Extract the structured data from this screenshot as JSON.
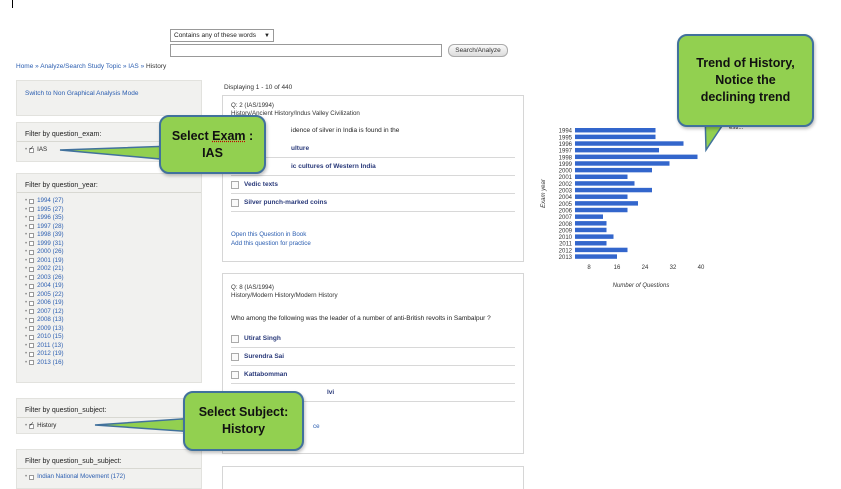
{
  "search": {
    "mode_select": "Contains any of these words",
    "input_value": "",
    "button_label": "Search/Analyze"
  },
  "breadcrumb": {
    "home": "Home",
    "sep": " » ",
    "analyze": "Analyze/Search Study Topic",
    "exam": "IAS",
    "current": "History"
  },
  "sidebar": {
    "mode_link": "Switch to Non Graphical Analysis Mode",
    "exam_filter": {
      "title": "Filter by question_exam:",
      "items": [
        {
          "label": "IAS",
          "checked": true
        }
      ]
    },
    "year_filter": {
      "title": "Filter by question_year:",
      "items": [
        "1994 (27)",
        "1995 (27)",
        "1996 (35)",
        "1997 (28)",
        "1998 (39)",
        "1999 (31)",
        "2000 (26)",
        "2001 (19)",
        "2002 (21)",
        "2003 (26)",
        "2004 (19)",
        "2005 (22)",
        "2006 (19)",
        "2007 (12)",
        "2008 (13)",
        "2009 (13)",
        "2010 (15)",
        "2011 (13)",
        "2012 (19)",
        "2013 (16)"
      ]
    },
    "subject_filter": {
      "title": "Filter by question_subject:",
      "items": [
        {
          "label": "History",
          "checked": true
        }
      ]
    },
    "subsubject_filter": {
      "title": "Filter by question_sub_subject:",
      "items": [
        "Indian National Movement (172)"
      ]
    }
  },
  "main": {
    "displaying": "Displaying 1 - 10 of 440",
    "q1": {
      "number": "Q: 2 (IAS/1994)",
      "path": "History/Ancient History/Indus Valley Civilization",
      "text": "The earliest evidence of silver in India is found in the",
      "text_visible": "idence of silver in India is found in the",
      "options": [
        "Harappan culture",
        "Chalcolithic cultures of Western India",
        "Vedic texts",
        "Silver punch-marked coins"
      ],
      "options_visible": [
        "ulture",
        "ic cultures of Western India",
        "Vedic texts",
        "Silver punch-marked coins"
      ],
      "link_book": "Open this Question in Book",
      "link_practice": "Add this question for practice"
    },
    "q2": {
      "number": "Q: 8 (IAS/1994)",
      "path": "History/Modern History/Modern History",
      "text": "Who among the following was the leader of a number of anti-British revolts in Sambalpur ?",
      "options_visible": [
        "Utirat Singh",
        "Surendra  Sai",
        "Kattabomman",
        "lvi"
      ],
      "link_visible": "ce"
    }
  },
  "chart_data": {
    "type": "bar",
    "orientation": "horizontal",
    "categories": [
      "1994",
      "1995",
      "1996",
      "1997",
      "1998",
      "1999",
      "2000",
      "2001",
      "2002",
      "2003",
      "2004",
      "2005",
      "2006",
      "2007",
      "2008",
      "2009",
      "2010",
      "2011",
      "2012",
      "2013"
    ],
    "values": [
      27,
      27,
      35,
      28,
      39,
      31,
      26,
      19,
      21,
      26,
      19,
      22,
      19,
      12,
      13,
      13,
      15,
      13,
      19,
      16
    ],
    "xlabel": "Number of Questions",
    "ylabel": "Exam year",
    "xticks": [
      8,
      16,
      24,
      32,
      40
    ],
    "xlim": [
      4,
      44
    ],
    "bar_color": "#3366cc",
    "legend_fragment": "esti..."
  },
  "callouts": {
    "exam": {
      "line1_pre": "Select ",
      "line1_u": "Exam",
      "line1_post": " :",
      "line2": "IAS"
    },
    "subject": {
      "line1": "Select Subject:",
      "line2": "History"
    },
    "trend": {
      "line1": "Trend of History,",
      "line2": "Notice the",
      "line3": "declining trend"
    },
    "fill_color": "#92d050",
    "border_color": "#41719c"
  }
}
